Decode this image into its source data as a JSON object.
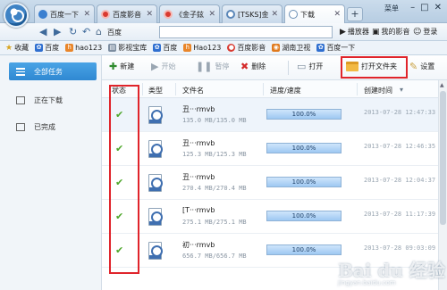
{
  "browser": {
    "tabs": [
      {
        "label": "百度一下",
        "icon": "baidu-paw-icon"
      },
      {
        "label": "百度影音",
        "icon": "baidu-player-icon"
      },
      {
        "label": "《金子鉉",
        "icon": "baidu-player-icon"
      },
      {
        "label": "[TSKS]金",
        "icon": "page-icon"
      },
      {
        "label": "下载",
        "icon": "download-icon",
        "active": true
      }
    ],
    "menu_label": "菜单",
    "home_label": "百度",
    "address_value": "",
    "tools": {
      "player": "播放器",
      "my_video": "我的影音",
      "login": "登录"
    },
    "bookmarks": [
      {
        "label": "收藏",
        "icon": "star-icon"
      },
      {
        "label": "百度",
        "icon": "baidu-paw-icon"
      },
      {
        "label": "hao123",
        "icon": "hao123-icon"
      },
      {
        "label": "影视宝库",
        "icon": "page-icon"
      },
      {
        "label": "百度",
        "icon": "baidu-paw-icon"
      },
      {
        "label": "Hao123",
        "icon": "hao123-icon"
      },
      {
        "label": "百度影音",
        "icon": "baidu-player-icon"
      },
      {
        "label": "湖南卫视",
        "icon": "tv-icon"
      },
      {
        "label": "百度一下",
        "icon": "baidu-paw-icon"
      }
    ]
  },
  "sidebar": {
    "items": [
      {
        "label": "全部任务",
        "icon": "list-icon",
        "active": true
      },
      {
        "label": "正在下载",
        "icon": "downloading-icon"
      },
      {
        "label": "已完成",
        "icon": "completed-icon"
      }
    ]
  },
  "toolbar": {
    "new": "新建",
    "start": "开始",
    "pause": "暂停",
    "delete": "删除",
    "open": "打开",
    "open_folder": "打开文件夹",
    "settings": "设置"
  },
  "table": {
    "columns": [
      "状态",
      "类型",
      "文件名",
      "进度/速度",
      "创建时间"
    ],
    "rows": [
      {
        "status": "✔",
        "name": "丑···rmvb",
        "size": "135.0 MB/135.0 MB",
        "progress": 1.0,
        "progress_text": "100.0%",
        "time": "2013-07-28 12:47:33"
      },
      {
        "status": "✔",
        "name": "丑···rmvb",
        "size": "125.3 MB/125.3 MB",
        "progress": 1.0,
        "progress_text": "100.0%",
        "time": "2013-07-28 12:46:35"
      },
      {
        "status": "✔",
        "name": "丑···rmvb",
        "size": "270.4 MB/270.4 MB",
        "progress": 1.0,
        "progress_text": "100.0%",
        "time": "2013-07-28 12:04:37"
      },
      {
        "status": "✔",
        "name": "[T···rmvb",
        "size": "275.1 MB/275.1 MB",
        "progress": 1.0,
        "progress_text": "100.0%",
        "time": "2013-07-28 11:17:39"
      },
      {
        "status": "✔",
        "name": "初···rmvb",
        "size": "656.7 MB/656.7 MB",
        "progress": 1.0,
        "progress_text": "100.0%",
        "time": "2013-07-28 09:03:09"
      }
    ]
  },
  "watermark": {
    "text": "Bai du 经验",
    "sub": "jingyan.baidu.com"
  },
  "colors": {
    "highlight": "#e0242b",
    "check": "#4ea62a",
    "active_sidebar": "#2f88d2"
  }
}
